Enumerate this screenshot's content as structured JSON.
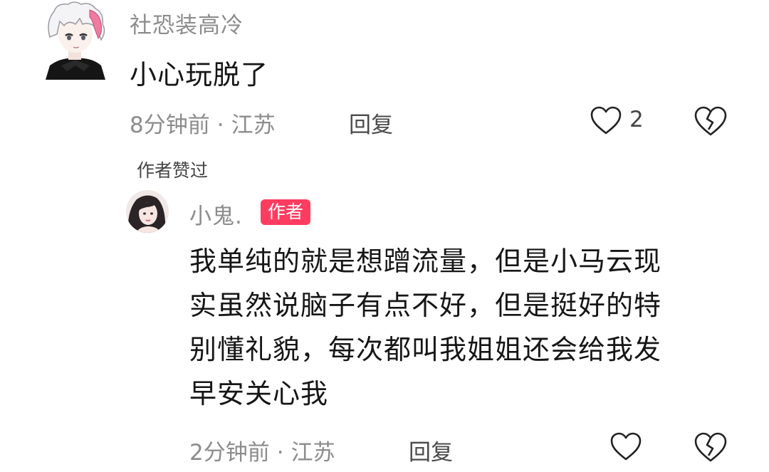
{
  "comment": {
    "username": "社恐装高冷",
    "text": "小心玩脱了",
    "time": "8分钟前",
    "separator": "·",
    "location": "江苏",
    "reply_label": "回复",
    "like_count": "2",
    "avatar": "anime-boy-avatar"
  },
  "author_liked_label": "作者赞过",
  "reply": {
    "username": "小鬼.",
    "author_badge": "作者",
    "text_lines": [
      "我单纯的就是想蹭流量，但是小马云现",
      "实虽然说脑子有点不好，但是挺好的特",
      "别懂礼貌，每次都叫我姐姐还会给我发",
      "早安关心我"
    ],
    "time": "2分钟前",
    "separator": "·",
    "location": "江苏",
    "reply_label": "回复",
    "avatar": "girl-avatar"
  },
  "colors": {
    "badge": "#fe3c5f",
    "meta_text": "#8c8c8c",
    "body_text": "#161616"
  },
  "icons": [
    "heart-outline-icon",
    "broken-heart-icon"
  ]
}
